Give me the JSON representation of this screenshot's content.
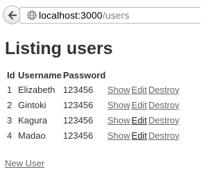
{
  "browser": {
    "url_host": "localhost:3000",
    "url_path": "/users"
  },
  "page": {
    "title": "Listing users",
    "new_user_link": "New User"
  },
  "table": {
    "headers": [
      "Id",
      "Username",
      "Password"
    ],
    "rows": [
      {
        "id": "1",
        "username": "Elizabeth",
        "password": "123456",
        "show": "Show",
        "edit": "Edit",
        "destroy": "Destroy"
      },
      {
        "id": "2",
        "username": "Gintoki",
        "password": "123456",
        "show": "Show",
        "edit": "Edit",
        "destroy": "Destroy"
      },
      {
        "id": "3",
        "username": "Kagura",
        "password": "123456",
        "show": "Show",
        "edit": "Edit",
        "destroy": "Destroy"
      },
      {
        "id": "4",
        "username": "Madao",
        "password": "123456",
        "show": "Show",
        "edit": "Edit",
        "destroy": "Destroy"
      }
    ]
  }
}
